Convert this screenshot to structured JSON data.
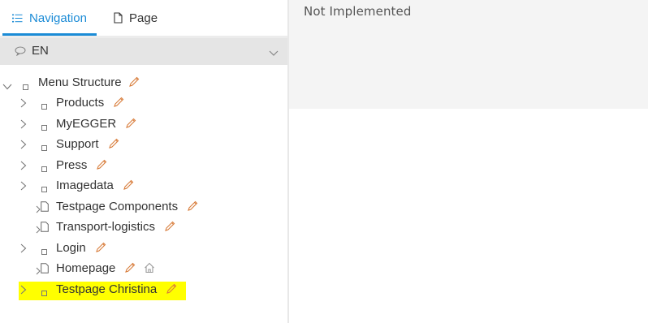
{
  "tabs": {
    "navigation_label": "Navigation",
    "navigation_icon": "list-icon",
    "page_label": "Page",
    "page_icon": "file-icon",
    "active": "Navigation"
  },
  "language": {
    "value": "EN",
    "icon": "speech-bubble-icon"
  },
  "tree": {
    "root": {
      "label": "Menu Structure"
    },
    "items": [
      {
        "label": "Products",
        "type": "folder",
        "expandable": true
      },
      {
        "label": "MyEGGER",
        "type": "folder",
        "expandable": true
      },
      {
        "label": "Support",
        "type": "folder",
        "expandable": true
      },
      {
        "label": "Press",
        "type": "folder",
        "expandable": true
      },
      {
        "label": "Imagedata",
        "type": "folder",
        "expandable": true
      },
      {
        "label": "Testpage Components",
        "type": "page",
        "expandable": true
      },
      {
        "label": "Transport-logistics",
        "type": "page",
        "expandable": true
      },
      {
        "label": "Login",
        "type": "folder",
        "expandable": true
      },
      {
        "label": "Homepage",
        "type": "page",
        "expandable": true,
        "home": true
      },
      {
        "label": "Testpage Christina",
        "type": "folder",
        "expandable": true,
        "highlighted": true
      }
    ]
  },
  "main": {
    "message": "Not Implemented"
  },
  "colors": {
    "accent": "#1b8bd6",
    "edit_icon": "#d87d3c",
    "highlight": "#ffff00"
  }
}
